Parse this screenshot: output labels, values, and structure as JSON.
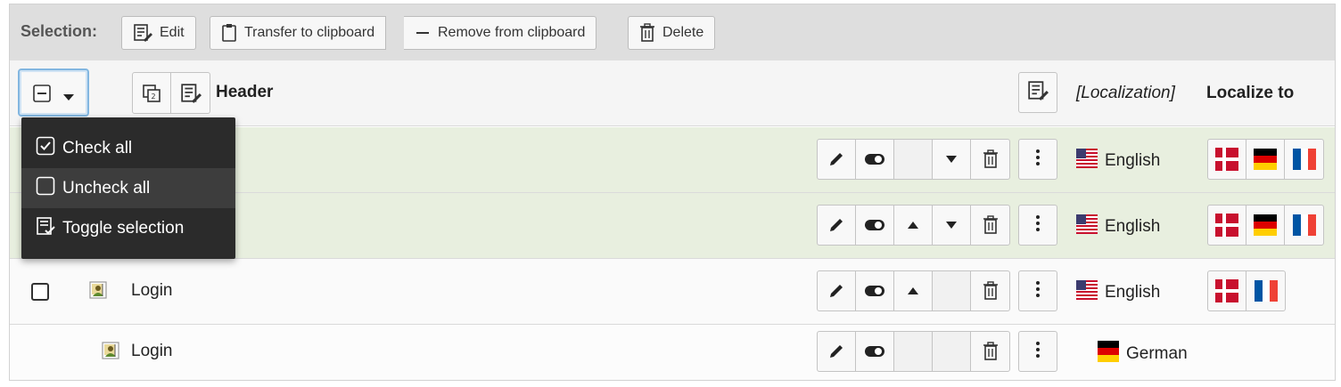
{
  "selection_bar": {
    "label": "Selection:",
    "edit": "Edit",
    "transfer": "Transfer to clipboard",
    "remove": "Remove from clipboard",
    "delete": "Delete"
  },
  "header": {
    "column_title": "Header",
    "localization": "[Localization]",
    "localize_to": "Localize to"
  },
  "dropdown": {
    "items": [
      "Check all",
      "Uncheck all",
      "Toggle selection"
    ]
  },
  "rows": [
    {
      "title": "",
      "language": "English",
      "localize_flags": [
        "flag-denmark-icon",
        "flag-germany-icon",
        "flag-france-icon"
      ]
    },
    {
      "title": "",
      "language": "English",
      "localize_flags": [
        "flag-denmark-icon",
        "flag-germany-icon",
        "flag-france-icon"
      ]
    },
    {
      "title": "Login",
      "language": "English",
      "localize_flags": [
        "flag-denmark-icon",
        "flag-france-icon"
      ]
    },
    {
      "title": "Login",
      "language": "German",
      "localize_flags": []
    }
  ],
  "colors": {
    "selected_row": "#e8efdf",
    "dropdown_bg": "#2b2b2b",
    "focus_ring": "#82b6e0"
  }
}
